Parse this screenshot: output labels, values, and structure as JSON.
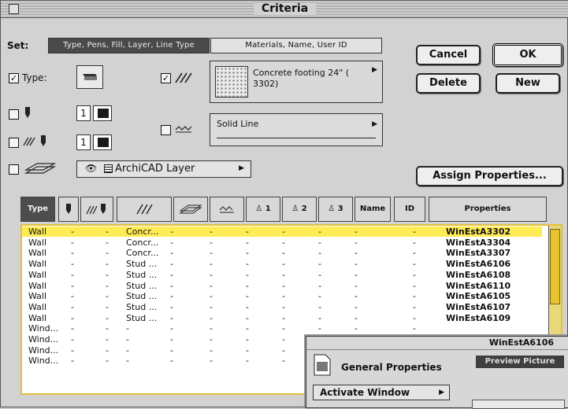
{
  "window": {
    "title": "Criteria"
  },
  "set": {
    "label": "Set:",
    "tab_active": "Type, Pens, Fill, Layer, Line Type",
    "tab_inactive": "Materials, Name, User ID"
  },
  "buttons": {
    "cancel": "Cancel",
    "ok": "OK",
    "delete": "Delete",
    "new": "New",
    "assign": "Assign Properties..."
  },
  "criteria": {
    "type_label": "Type:",
    "fill_value": "Concrete footing 24\" ( 3302)",
    "line_type_value": "Solid Line",
    "pen1_value": "1",
    "pen2_value": "1",
    "layer_value": "ArchiCAD Layer"
  },
  "table": {
    "headers": [
      "Type",
      "",
      "",
      "",
      "",
      "",
      "1",
      "2",
      "3",
      "Name",
      "ID",
      "Properties"
    ],
    "rows": [
      {
        "type": "Wall",
        "c1": "-",
        "c2": "-",
        "fill": "Concr...",
        "c4": "-",
        "c5": "-",
        "c6": "-",
        "c7": "-",
        "c8": "-",
        "c9": "-",
        "c10": "-",
        "prop": "WinEstA3302"
      },
      {
        "type": "Wall",
        "c1": "-",
        "c2": "-",
        "fill": "Concr...",
        "c4": "-",
        "c5": "-",
        "c6": "-",
        "c7": "-",
        "c8": "-",
        "c9": "-",
        "c10": "-",
        "prop": "WinEstA3304"
      },
      {
        "type": "Wall",
        "c1": "-",
        "c2": "-",
        "fill": "Concr...",
        "c4": "-",
        "c5": "-",
        "c6": "-",
        "c7": "-",
        "c8": "-",
        "c9": "-",
        "c10": "-",
        "prop": "WinEstA3307"
      },
      {
        "type": "Wall",
        "c1": "-",
        "c2": "-",
        "fill": "Stud ...",
        "c4": "-",
        "c5": "-",
        "c6": "-",
        "c7": "-",
        "c8": "-",
        "c9": "-",
        "c10": "-",
        "prop": "WinEstA6106"
      },
      {
        "type": "Wall",
        "c1": "-",
        "c2": "-",
        "fill": "Stud ...",
        "c4": "-",
        "c5": "-",
        "c6": "-",
        "c7": "-",
        "c8": "-",
        "c9": "-",
        "c10": "-",
        "prop": "WinEstA6108"
      },
      {
        "type": "Wall",
        "c1": "-",
        "c2": "-",
        "fill": "Stud ...",
        "c4": "-",
        "c5": "-",
        "c6": "-",
        "c7": "-",
        "c8": "-",
        "c9": "-",
        "c10": "-",
        "prop": "WinEstA6110"
      },
      {
        "type": "Wall",
        "c1": "-",
        "c2": "-",
        "fill": "Stud ...",
        "c4": "-",
        "c5": "-",
        "c6": "-",
        "c7": "-",
        "c8": "-",
        "c9": "-",
        "c10": "-",
        "prop": "WinEstA6105"
      },
      {
        "type": "Wall",
        "c1": "-",
        "c2": "-",
        "fill": "Stud ...",
        "c4": "-",
        "c5": "-",
        "c6": "-",
        "c7": "-",
        "c8": "-",
        "c9": "-",
        "c10": "-",
        "prop": "WinEstA6107"
      },
      {
        "type": "Wall",
        "c1": "-",
        "c2": "-",
        "fill": "Stud ...",
        "c4": "-",
        "c5": "-",
        "c6": "-",
        "c7": "-",
        "c8": "-",
        "c9": "-",
        "c10": "-",
        "prop": "WinEstA6109"
      },
      {
        "type": "Wind...",
        "c1": "-",
        "c2": "-",
        "fill": "-",
        "c4": "-",
        "c5": "-",
        "c6": "-",
        "c7": "-",
        "c8": "-",
        "c9": "-",
        "c10": "-",
        "prop": ""
      },
      {
        "type": "Wind...",
        "c1": "-",
        "c2": "-",
        "fill": "-",
        "c4": "-",
        "c5": "-",
        "c6": "-",
        "c7": "-",
        "c8": "-",
        "c9": "-",
        "c10": "-",
        "prop": ""
      },
      {
        "type": "Wind...",
        "c1": "-",
        "c2": "-",
        "fill": "-",
        "c4": "-",
        "c5": "-",
        "c6": "-",
        "c7": "-",
        "c8": "-",
        "c9": "-",
        "c10": "-",
        "prop": ""
      },
      {
        "type": "Wind...",
        "c1": "-",
        "c2": "-",
        "fill": "-",
        "c4": "-",
        "c5": "-",
        "c6": "-",
        "c7": "-",
        "c8": "-",
        "c9": "-",
        "c10": "-",
        "prop": ""
      }
    ]
  },
  "overlay": {
    "header_value": "WinEstA6106",
    "title": "General Properties",
    "preview_button": "Preview Picture",
    "menu_item": "Activate Window"
  },
  "colors": {
    "highlight": "#ffeb55",
    "list_border": "#e3c13a"
  },
  "icons": [
    "pen-icon",
    "fill-pattern-icon",
    "layer-icon",
    "line-type-icon",
    "eye-icon",
    "triangle-right-icon"
  ]
}
